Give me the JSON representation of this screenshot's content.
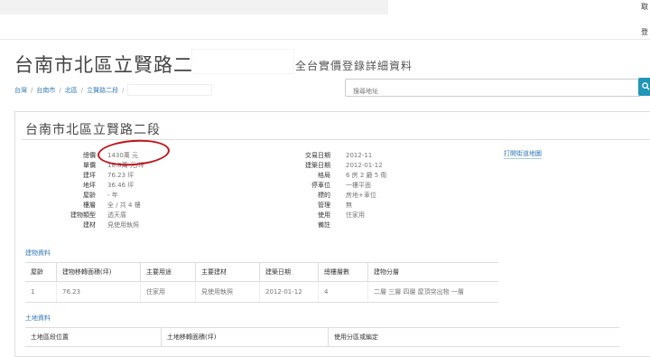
{
  "topbar": {
    "right_top": "取",
    "right_mid": "登"
  },
  "header": {
    "title": "台南市北區立賢路二段",
    "subtitle": "全台實價登錄詳細資料"
  },
  "breadcrumb": [
    "台灣",
    "台南市",
    "北區",
    "立賢路二段"
  ],
  "search": {
    "placeholder": "搜尋地址"
  },
  "panel": {
    "title": "台南市北區立賢路二段"
  },
  "details_left": [
    {
      "label": "總價",
      "value": "1430萬 元"
    },
    {
      "label": "單價",
      "value": "18.8萬 元/坪"
    },
    {
      "label": "建坪",
      "value": "76.23 坪"
    },
    {
      "label": "地坪",
      "value": "36.46 坪"
    },
    {
      "label": "屋齡",
      "value": "- 年"
    },
    {
      "label": "樓層",
      "value": "全 / 共 4 樓"
    },
    {
      "label": "建物類型",
      "value": "透天厝"
    },
    {
      "label": "建材",
      "value": "見使用執照"
    }
  ],
  "details_right": [
    {
      "label": "交易日期",
      "value": "2012-11"
    },
    {
      "label": "建築日期",
      "value": "2012-01-12"
    },
    {
      "label": "格局",
      "value": "6 房 2 廳 5 衛"
    },
    {
      "label": "停車位",
      "value": "一樓平面"
    },
    {
      "label": "標的",
      "value": "房地+車位"
    },
    {
      "label": "管理",
      "value": "無"
    },
    {
      "label": "使用",
      "value": "住家用"
    },
    {
      "label": "備註",
      "value": ""
    }
  ],
  "map_link": "打開街道地圖",
  "building": {
    "section_title": "建物資料",
    "headers": [
      "屋齡",
      "建物移轉面積(坪)",
      "主要用途",
      "主要建材",
      "建築日期",
      "總樓層數",
      "建物分層"
    ],
    "rows": [
      [
        "1",
        "76.23",
        "住家用",
        "見使用執照",
        "2012-01-12",
        "4",
        "二層 三層 四層 屋頂突出物 一層"
      ]
    ]
  },
  "land": {
    "section_title": "土地資料",
    "headers": [
      "土地區段位置",
      "土地移轉面積(坪)",
      "使用分區或編定"
    ]
  },
  "colors": {
    "link": "#337ab7",
    "annotation_circle": "#c0141b",
    "search_button": "#2196b6"
  }
}
